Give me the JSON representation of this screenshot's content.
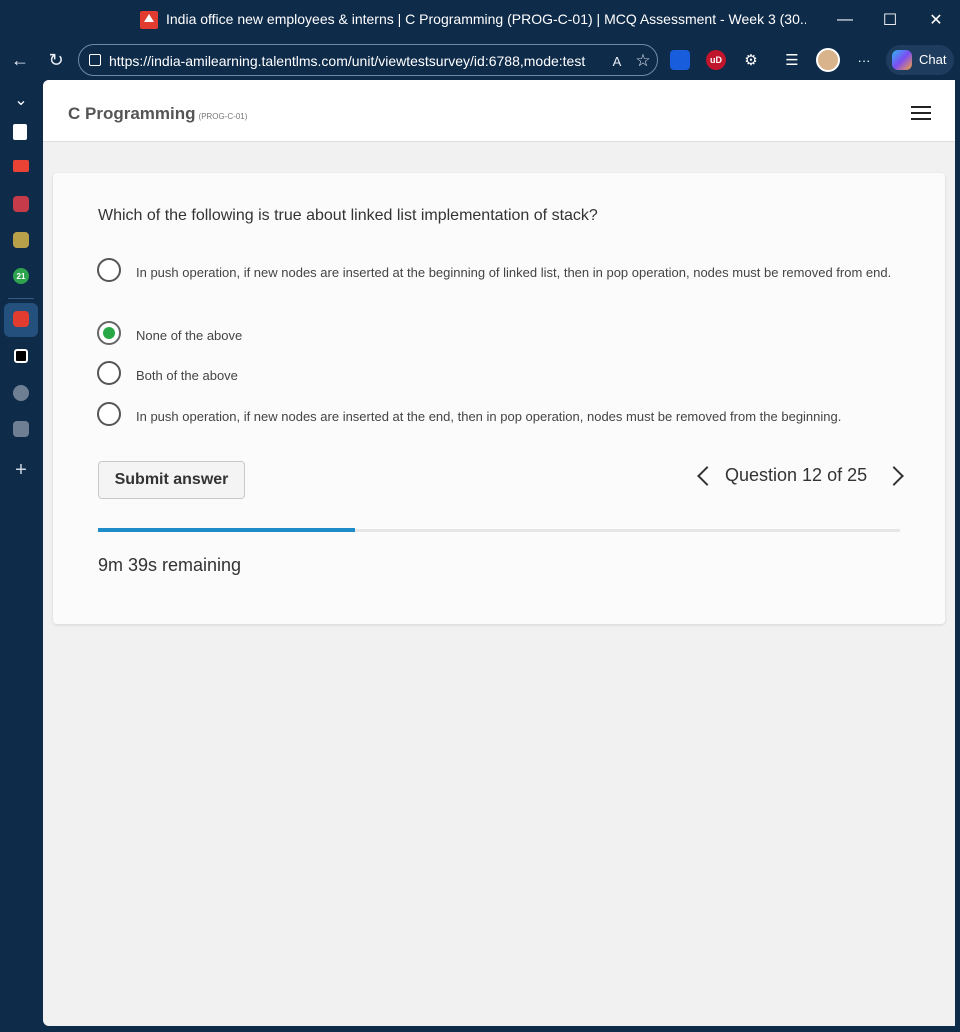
{
  "window": {
    "title": "India office new employees & interns | C Programming (PROG-C-01) | MCQ Assessment - Week 3 (30...",
    "minimize_glyph": "—",
    "maximize_glyph": "☐",
    "close_glyph": "✕"
  },
  "browser": {
    "url": "https://india-amilearning.talentlms.com/unit/viewtestsurvey/id:6788,mode:test",
    "back_glyph": "←",
    "refresh_glyph": "↻",
    "read_aloud_glyph": "A",
    "favorite_glyph": "☆",
    "extensions_glyph": "⚙",
    "favorites_glyph": "☰",
    "more_glyph": "···",
    "chat_label": "Chat",
    "ext_ublock_label": "uD",
    "colors": {
      "chrome_bg": "#0f2b4a",
      "ublock": "#c0162c",
      "bitwarden": "#175ddc"
    }
  },
  "sidebar": {
    "collapse_glyph": "⌄",
    "add_glyph": "+",
    "badge_count": "21"
  },
  "app": {
    "course_title": "C Programming",
    "course_code": "(PROG-C-01)"
  },
  "quiz": {
    "question": "Which of the following is true about linked list implementation of stack?",
    "options": [
      {
        "text": "In push operation, if new nodes are inserted at the beginning of linked list, then in pop operation, nodes must be removed from end.",
        "selected": false
      },
      {
        "text": "None of the above",
        "selected": true
      },
      {
        "text": "Both of the above",
        "selected": false
      },
      {
        "text": "In push operation, if new nodes are inserted at the end, then in pop operation, nodes must be removed from the beginning.",
        "selected": false
      }
    ],
    "submit_label": "Submit answer",
    "question_counter": "Question 12 of 25",
    "progress_fraction": 0.32,
    "time_remaining": "9m 39s remaining",
    "colors": {
      "selected_radio": "#27a844",
      "progress": "#1e8cc8"
    }
  }
}
